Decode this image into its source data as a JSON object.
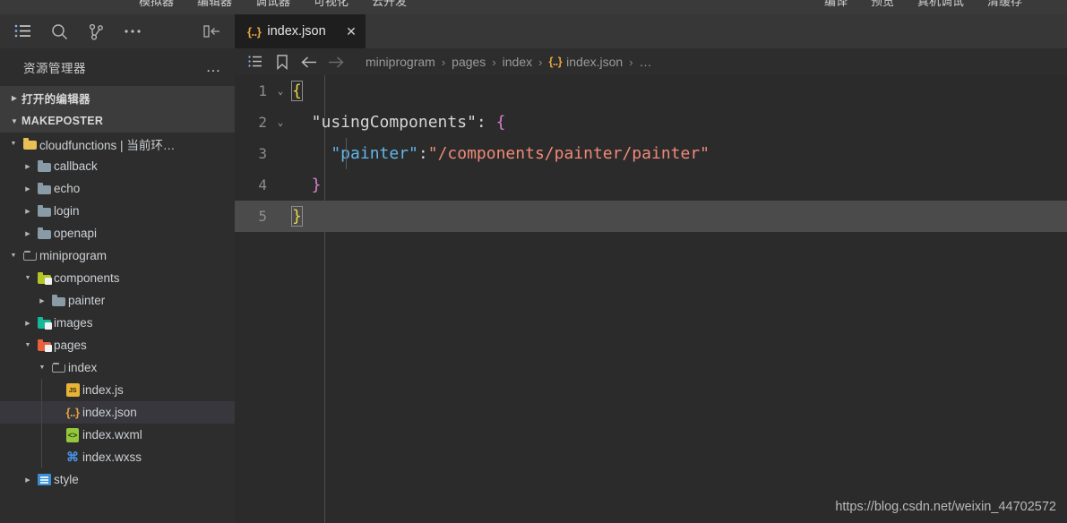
{
  "app_toolbar": {
    "left_items": [
      "模拟器",
      "编辑器",
      "调试器",
      "可视化",
      "云开发"
    ],
    "right_items": [
      "编译",
      "预览",
      "真机调试",
      "清缓存"
    ]
  },
  "activity_bar": {
    "icons": [
      {
        "name": "explorer-icon",
        "label": "资源管理器"
      },
      {
        "name": "search-icon",
        "label": "搜索"
      },
      {
        "name": "source-control-icon",
        "label": "源代码管理"
      },
      {
        "name": "more-icon",
        "label": "更多"
      }
    ],
    "collapse_label": "折叠侧边栏"
  },
  "sidebar": {
    "title": "资源管理器",
    "more_label": "…",
    "sections": [
      {
        "label": "打开的编辑器",
        "expanded": false
      },
      {
        "label": "MAKEPOSTER",
        "expanded": true
      }
    ],
    "tree": [
      {
        "label": "cloudfunctions | 当前环…",
        "depth": 1,
        "twisty": "▼",
        "icon": "folder-yellow",
        "selected": false
      },
      {
        "label": "callback",
        "depth": 2,
        "twisty": "▶",
        "icon": "folder-gray",
        "selected": false
      },
      {
        "label": "echo",
        "depth": 2,
        "twisty": "▶",
        "icon": "folder-gray",
        "selected": false
      },
      {
        "label": "login",
        "depth": 2,
        "twisty": "▶",
        "icon": "folder-gray",
        "selected": false
      },
      {
        "label": "openapi",
        "depth": 2,
        "twisty": "▶",
        "icon": "folder-gray",
        "selected": false
      },
      {
        "label": "miniprogram",
        "depth": 1,
        "twisty": "▼",
        "icon": "folder-open-gray",
        "selected": false
      },
      {
        "label": "components",
        "depth": 2,
        "twisty": "▼",
        "icon": "folder-lime",
        "selected": false
      },
      {
        "label": "painter",
        "depth": 3,
        "twisty": "▶",
        "icon": "folder-gray",
        "selected": false
      },
      {
        "label": "images",
        "depth": 2,
        "twisty": "▶",
        "icon": "folder-teal",
        "selected": false
      },
      {
        "label": "pages",
        "depth": 2,
        "twisty": "▼",
        "icon": "folder-red",
        "selected": false
      },
      {
        "label": "index",
        "depth": 3,
        "twisty": "▼",
        "icon": "folder-open-gray",
        "selected": false
      },
      {
        "label": "index.js",
        "depth": 4,
        "twisty": "",
        "icon": "file-js",
        "selected": false
      },
      {
        "label": "index.json",
        "depth": 4,
        "twisty": "",
        "icon": "file-json",
        "selected": true
      },
      {
        "label": "index.wxml",
        "depth": 4,
        "twisty": "",
        "icon": "file-wxml",
        "selected": false
      },
      {
        "label": "index.wxss",
        "depth": 4,
        "twisty": "",
        "icon": "file-wxss",
        "selected": false
      },
      {
        "label": "style",
        "depth": 2,
        "twisty": "▶",
        "icon": "folder-blue-style",
        "selected": false
      }
    ]
  },
  "tabs": [
    {
      "label": "index.json",
      "icon": "{..}",
      "close": "✕",
      "active": true
    }
  ],
  "breadcrumb": {
    "buttons": [
      "outline-icon",
      "bookmark-icon",
      "back-arrow-icon",
      "forward-arrow-icon"
    ],
    "segments": [
      "miniprogram",
      "pages",
      "index",
      "index.json",
      "…"
    ],
    "separator": "›",
    "file_icon": "{..}"
  },
  "editor": {
    "lines": [
      {
        "num": "1",
        "fold": "⌄",
        "current": false,
        "tokens": [
          {
            "t": "{",
            "c": "c-punct",
            "match": true
          }
        ]
      },
      {
        "num": "2",
        "fold": "⌄",
        "current": false,
        "tokens": [
          {
            "t": "  \"usingComponents\"",
            "c": "c-key"
          },
          {
            "t": ": ",
            "c": "c-colon"
          },
          {
            "t": "{",
            "c": "c-brace"
          }
        ]
      },
      {
        "num": "3",
        "fold": "",
        "current": false,
        "indent_guide": true,
        "tokens": [
          {
            "t": "    \"painter\"",
            "c": "c-key2"
          },
          {
            "t": ":",
            "c": "c-colon"
          },
          {
            "t": "\"/components/painter/painter\"",
            "c": "c-str"
          }
        ]
      },
      {
        "num": "4",
        "fold": "",
        "current": false,
        "tokens": [
          {
            "t": "  }",
            "c": "c-brace"
          }
        ]
      },
      {
        "num": "5",
        "fold": "",
        "current": true,
        "tokens": [
          {
            "t": "}",
            "c": "c-punct",
            "match": true
          }
        ]
      }
    ]
  },
  "watermark": "https://blog.csdn.net/weixin_44702572",
  "colors": {
    "editor_bg": "#2b2b2b",
    "sidebar_bg": "#2d2d2d",
    "tabbar_bg": "#373737",
    "tab_active_bg": "#1e1e1e",
    "selection_bg": "#37373d",
    "current_line_bg": "#4b4b4b",
    "json_accent": "#e8a33d",
    "string_color": "#f08a78",
    "brace_color": "#d97fd1"
  }
}
